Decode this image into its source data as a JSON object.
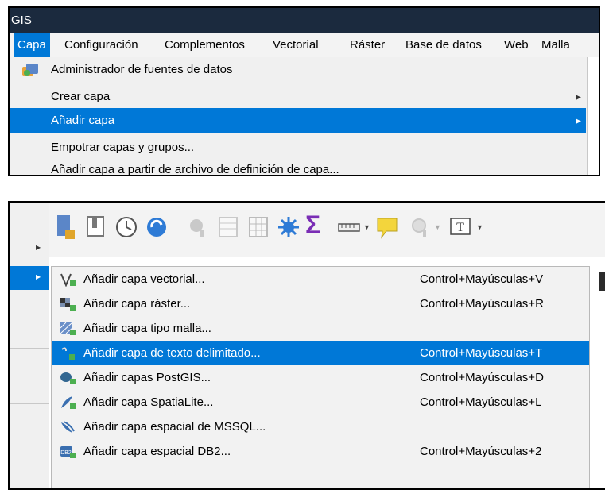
{
  "window": {
    "title": "GIS"
  },
  "menubar": [
    {
      "label": "Capa",
      "active": true
    },
    {
      "label": "Configuración"
    },
    {
      "label": "Complementos"
    },
    {
      "label": "Vectorial"
    },
    {
      "label": "Ráster"
    },
    {
      "label": "Base de datos"
    },
    {
      "label": "Web"
    },
    {
      "label": "Malla"
    }
  ],
  "capa_menu": [
    {
      "label": "Administrador de fuentes de datos",
      "icon": "data-source-manager-icon"
    },
    {
      "label": "Crear capa",
      "has_submenu": true
    },
    {
      "label": "Añadir capa",
      "has_submenu": true,
      "highlighted": true
    },
    {
      "label": "Empotrar capas y grupos..."
    },
    {
      "label": "Añadir capa a partir de archivo de definición de capa..."
    }
  ],
  "add_layer_submenu": [
    {
      "label": "Añadir capa vectorial...",
      "shortcut": "Control+Mayúsculas+V",
      "icon": "vector-layer-icon"
    },
    {
      "label": "Añadir capa ráster...",
      "shortcut": "Control+Mayúsculas+R",
      "icon": "raster-layer-icon"
    },
    {
      "label": "Añadir capa tipo malla...",
      "shortcut": "",
      "icon": "mesh-layer-icon"
    },
    {
      "label": "Añadir capa de texto delimitado...",
      "shortcut": "Control+Mayúsculas+T",
      "icon": "delimited-text-icon",
      "highlighted": true
    },
    {
      "label": "Añadir capas PostGIS...",
      "shortcut": "Control+Mayúsculas+D",
      "icon": "postgis-icon"
    },
    {
      "label": "Añadir capa SpatiaLite...",
      "shortcut": "Control+Mayúsculas+L",
      "icon": "spatialite-icon"
    },
    {
      "label": "Añadir capa espacial de MSSQL...",
      "shortcut": "",
      "icon": "mssql-icon"
    },
    {
      "label": "Añadir capa espacial DB2...",
      "shortcut": "Control+Mayúsculas+2",
      "icon": "db2-icon"
    }
  ],
  "toolbar_icons": [
    "new-layer-icon",
    "bookmark-icon",
    "clock-icon",
    "refresh-icon",
    "identify-icon",
    "attribute-table-icon",
    "statistics-grid-icon",
    "gear-star-icon",
    "sum-icon",
    "measure-icon",
    "annotation-icon",
    "zoom-select-icon",
    "text-annotation-icon"
  ],
  "colors": {
    "highlight": "#0078d7",
    "titlebar": "#1b2a3e",
    "menu_bg": "#f0f0f0"
  }
}
